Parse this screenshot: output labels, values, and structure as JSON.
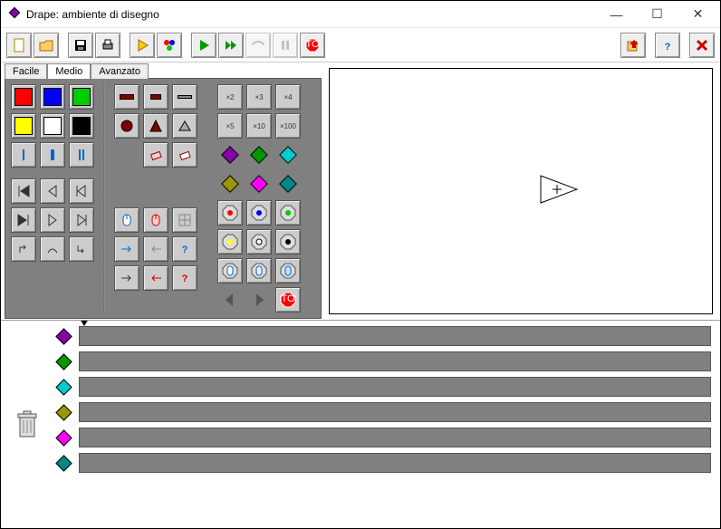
{
  "window": {
    "title": "Drape: ambiente di disegno"
  },
  "win_controls": {
    "min": "—",
    "max": "☐",
    "close": "✕"
  },
  "tabs": {
    "items": [
      "Facile",
      "Medio",
      "Avanzato"
    ],
    "active": 1
  },
  "palette": {
    "fillColors": [
      "#ff0000",
      "#0000ff",
      "#00cc00",
      "#ffff00",
      "#ffffff",
      "#000000"
    ],
    "shapeRow1": [
      "rect-wide",
      "rect-wide",
      "rect-wide"
    ],
    "shapeRow2": [
      "circle",
      "triangle",
      "triangle-up"
    ],
    "multipliers1": [
      "×2",
      "×3",
      "×4"
    ],
    "multipliers2": [
      "×5",
      "×10",
      "×100"
    ],
    "diamondsRow1": [
      "#8800aa",
      "#009900",
      "#00cccc"
    ],
    "diamondsRow2": [
      "#999900",
      "#ff00ff",
      "#008888"
    ],
    "runLabel": "STOP"
  },
  "tracks": {
    "colors": [
      "#8800aa",
      "#009900",
      "#00cccc",
      "#999900",
      "#ff00ff",
      "#008888"
    ]
  }
}
